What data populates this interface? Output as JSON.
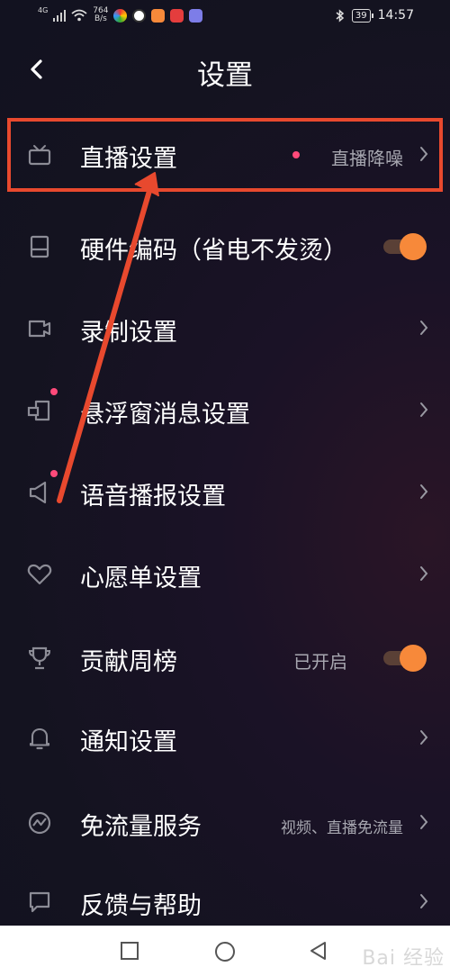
{
  "status_bar": {
    "network": "4G",
    "speed_value": "764",
    "speed_unit": "B/s",
    "battery": "39",
    "time": "14:57"
  },
  "header": {
    "title": "设置"
  },
  "settings": [
    {
      "id": "live",
      "label": "直播设置",
      "value": "直播降噪",
      "icon": "tv-icon",
      "has_dot": true,
      "control": "chevron"
    },
    {
      "id": "hw",
      "label": "硬件编码（省电不发烫）",
      "icon": "hardware-icon",
      "control": "toggle",
      "toggle_on": true
    },
    {
      "id": "record",
      "label": "录制设置",
      "icon": "video-camera-icon",
      "control": "chevron"
    },
    {
      "id": "float",
      "label": "悬浮窗消息设置",
      "icon": "floating-window-icon",
      "has_dot": true,
      "control": "chevron"
    },
    {
      "id": "voice",
      "label": "语音播报设置",
      "icon": "speaker-icon",
      "has_dot": true,
      "control": "chevron"
    },
    {
      "id": "wish",
      "label": "心愿单设置",
      "icon": "heart-icon",
      "control": "chevron"
    },
    {
      "id": "contrib",
      "label": "贡献周榜",
      "value": "已开启",
      "icon": "trophy-icon",
      "control": "toggle",
      "toggle_on": true
    },
    {
      "id": "notify",
      "label": "通知设置",
      "icon": "bell-icon",
      "control": "chevron"
    },
    {
      "id": "freeflow",
      "label": "免流量服务",
      "value": "视频、直播免流量",
      "icon": "free-flow-icon",
      "control": "chevron"
    },
    {
      "id": "feedback",
      "label": "反馈与帮助",
      "icon": "chat-icon",
      "control": "chevron"
    }
  ],
  "colors": {
    "accent_orange": "#f7893a",
    "highlight_red": "#e8492e",
    "dot_pink": "#ff4a7a"
  },
  "watermark": "Bai 经验"
}
